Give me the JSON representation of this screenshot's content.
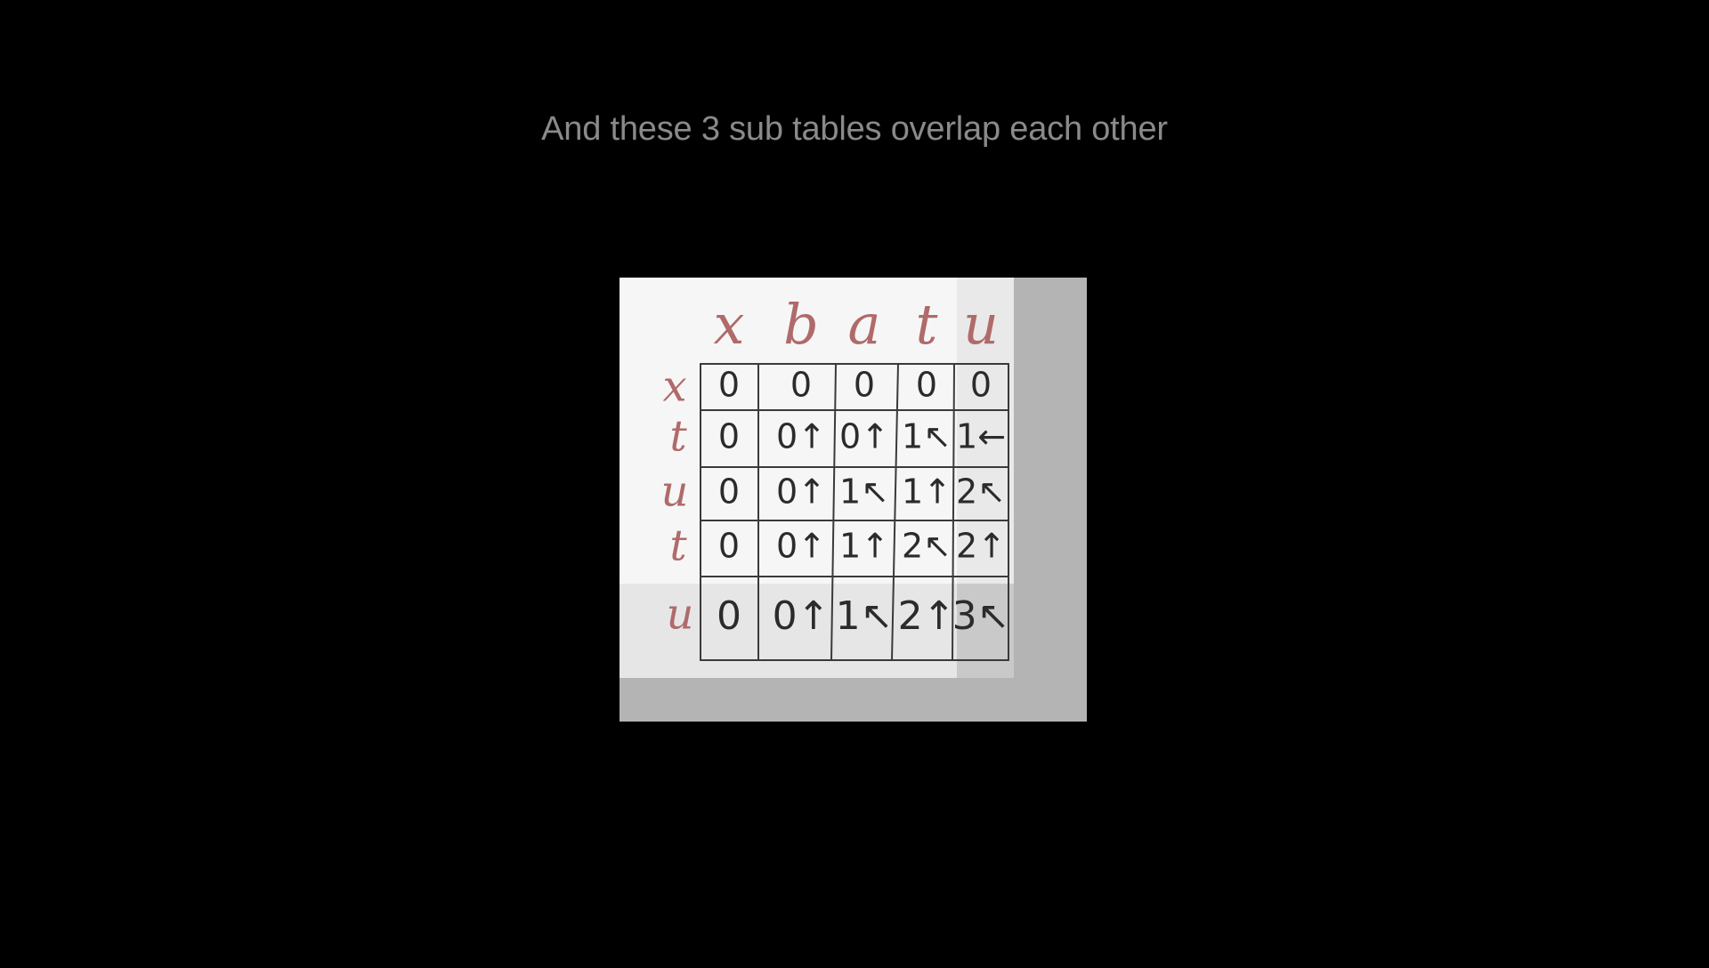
{
  "slide": {
    "caption": "And these 3 sub tables overlap each other"
  },
  "table": {
    "column_headers": [
      "x",
      "b",
      "a",
      "t",
      "u"
    ],
    "row_headers": [
      "x",
      "t",
      "u",
      "t",
      "u"
    ],
    "rows": [
      [
        "0",
        "0",
        "0",
        "0",
        "0"
      ],
      [
        "0",
        "0↑",
        "0↑",
        "1↖",
        "1←"
      ],
      [
        "0",
        "0↑",
        "1↖",
        "1↑",
        "2↖"
      ],
      [
        "0",
        "0↑",
        "1↑",
        "2↖",
        "2↑"
      ],
      [
        "0",
        "0↑",
        "1↖",
        "2↑",
        "3↖"
      ]
    ]
  },
  "colors": {
    "background": "#000000",
    "caption": "#8a8a8a",
    "ink": "#2b2b2b",
    "header_ink": "#b06a6a",
    "paper": "#f6f6f6",
    "sub_table_overlay": "#b4b4b4"
  }
}
